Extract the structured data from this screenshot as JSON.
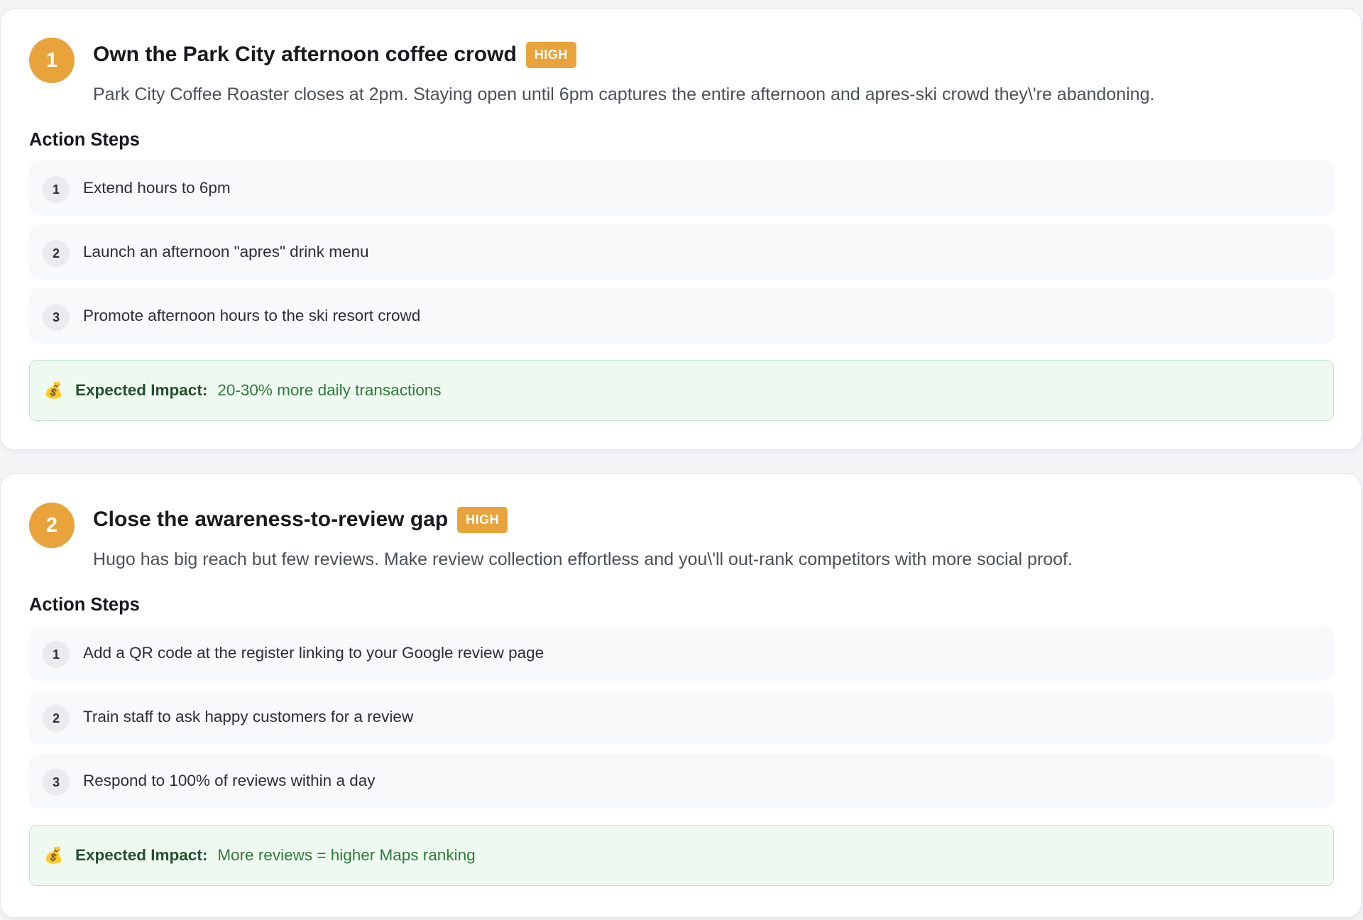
{
  "colors": {
    "accent": "#e8a33a",
    "impact_bg": "#eefaf0",
    "impact_border": "#bfe8c7",
    "impact_text": "#2f7a3c"
  },
  "steps_heading": "Action Steps",
  "impact_label": "Expected Impact:",
  "impact_icon": "money-bag-icon",
  "recommendations": [
    {
      "rank": "1",
      "title": "Own the Park City afternoon coffee crowd",
      "priority": "HIGH",
      "description": "Park City Coffee Roaster closes at 2pm. Staying open until 6pm captures the entire afternoon and apres-ski crowd they\\'re abandoning.",
      "steps": [
        {
          "num": "1",
          "text": "Extend hours to 6pm"
        },
        {
          "num": "2",
          "text": "Launch an afternoon \"apres\" drink menu"
        },
        {
          "num": "3",
          "text": "Promote afternoon hours to the ski resort crowd"
        }
      ],
      "impact": "20-30% more daily transactions"
    },
    {
      "rank": "2",
      "title": "Close the awareness-to-review gap",
      "priority": "HIGH",
      "description": "Hugo has big reach but few reviews. Make review collection effortless and you\\'ll out-rank competitors with more social proof.",
      "steps": [
        {
          "num": "1",
          "text": "Add a QR code at the register linking to your Google review page"
        },
        {
          "num": "2",
          "text": "Train staff to ask happy customers for a review"
        },
        {
          "num": "3",
          "text": "Respond to 100% of reviews within a day"
        }
      ],
      "impact": "More reviews = higher Maps ranking"
    }
  ]
}
